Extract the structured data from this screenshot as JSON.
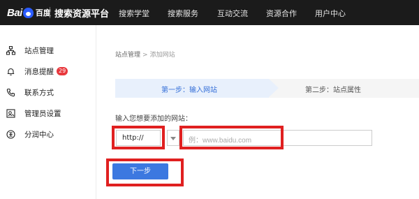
{
  "header": {
    "logo_text": "Bai",
    "logo_cn": "百度",
    "site_title": "搜索资源平台",
    "nav": [
      "搜索学堂",
      "搜索服务",
      "互动交流",
      "资源合作",
      "用户中心"
    ]
  },
  "sidebar": {
    "items": [
      {
        "label": "站点管理",
        "icon": "sitemap-icon"
      },
      {
        "label": "消息提醒",
        "icon": "bell-icon",
        "badge": "29"
      },
      {
        "label": "联系方式",
        "icon": "phone-icon"
      },
      {
        "label": "管理员设置",
        "icon": "admin-icon"
      },
      {
        "label": "分润中心",
        "icon": "coin-icon"
      }
    ]
  },
  "breadcrumb": {
    "root": "站点管理",
    "separator": ">",
    "current": "添加网站"
  },
  "steps": {
    "step1": "第一步：输入网站",
    "step2": "第二步：站点属性"
  },
  "form": {
    "label": "输入您想要添加的网站：",
    "protocol_value": "http://",
    "url_placeholder": "例：www.baidu.com",
    "next_label": "下一步"
  },
  "colors": {
    "accent": "#3c78e0",
    "highlight": "#e02020",
    "topbar": "#1b1b1b",
    "badge": "#e8383d"
  }
}
